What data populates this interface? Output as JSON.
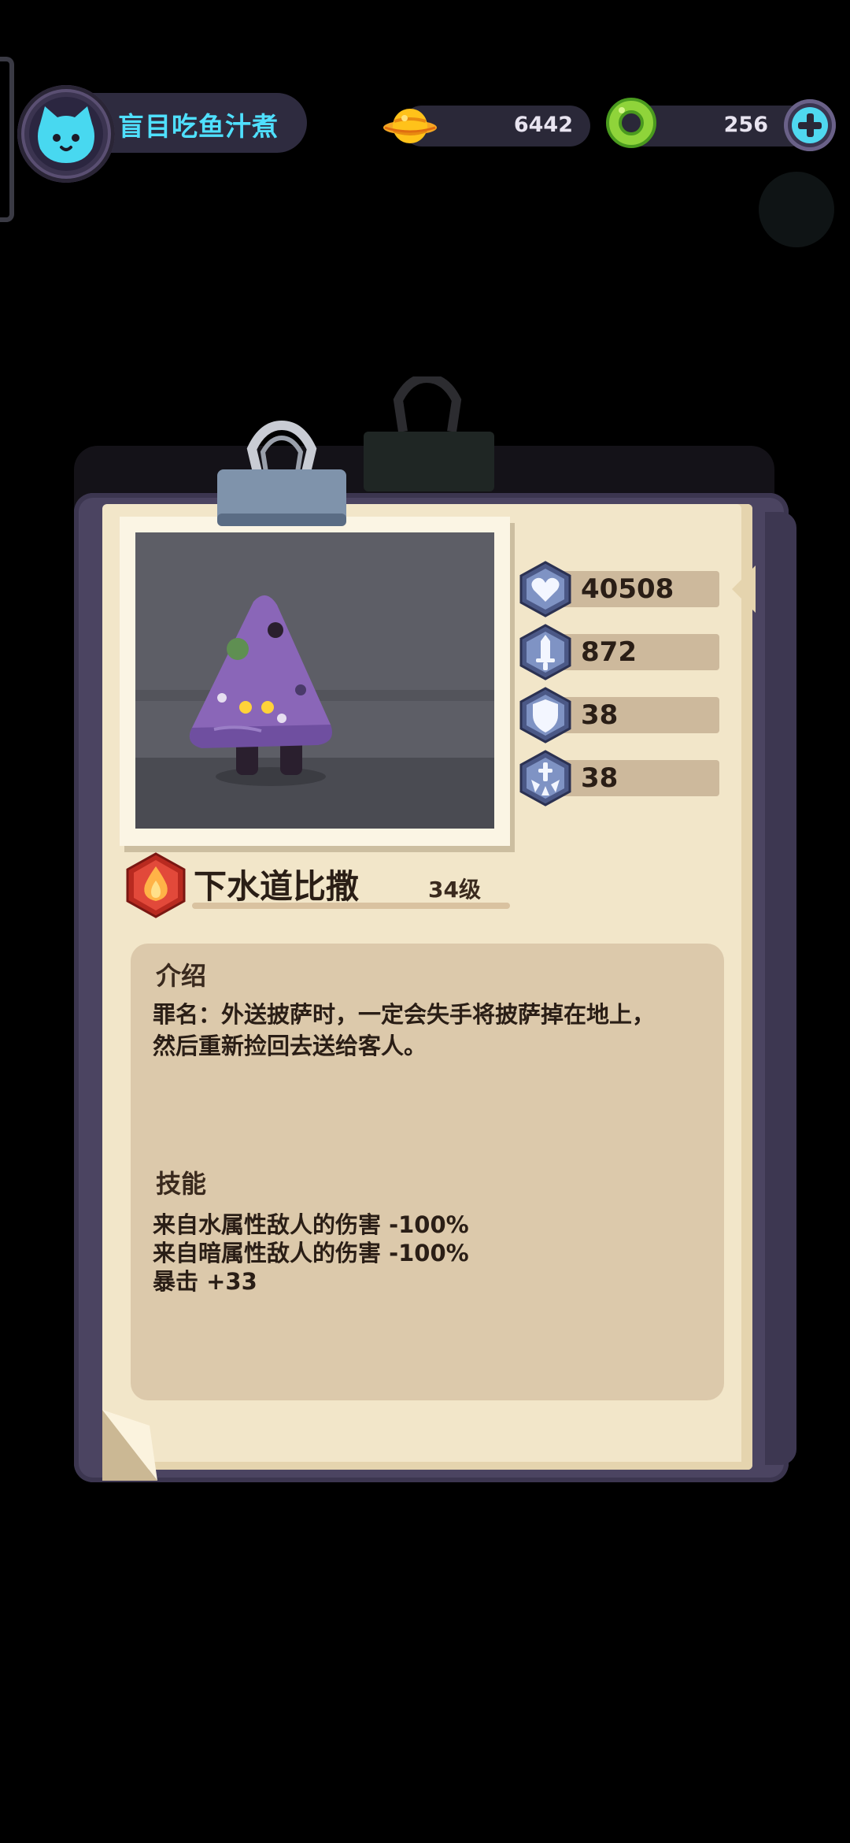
{
  "player": {
    "name": "盲目吃鱼汁煮",
    "avatar_icon": "cat-face-icon"
  },
  "currencies": {
    "coins": "6442",
    "coin_icon": "planet-coin-icon",
    "gems": "256",
    "gem_icon": "green-ring-gem-icon",
    "add_icon": "plus-icon"
  },
  "enemy": {
    "name": "下水道比撒",
    "level": "34级",
    "element_icon": "fire-element-icon",
    "portrait_icon": "pizza-slice-monster"
  },
  "stats": [
    {
      "icon": "heart-hp-icon",
      "value": "40508"
    },
    {
      "icon": "sword-attack-icon",
      "value": "872"
    },
    {
      "icon": "shield-defense-icon",
      "value": "38"
    },
    {
      "icon": "crit-burst-icon",
      "value": "38"
    }
  ],
  "intro": {
    "heading": "介绍",
    "text": "罪名：外送披萨时，一定会失手将披萨掉在地上，\n然后重新捡回去送给客人。"
  },
  "skills": {
    "heading": "技能",
    "lines": [
      "来自水属性敌人的伤害 -100%",
      "来自暗属性敌人的伤害 -100%",
      "暴击 +33"
    ]
  },
  "colors": {
    "accent_cyan": "#4fe0ff",
    "paper": "#f2e6c9",
    "panel": "#dcc9ab",
    "clipboard": "#4b4461",
    "fire_badge": "#d93a2b"
  }
}
